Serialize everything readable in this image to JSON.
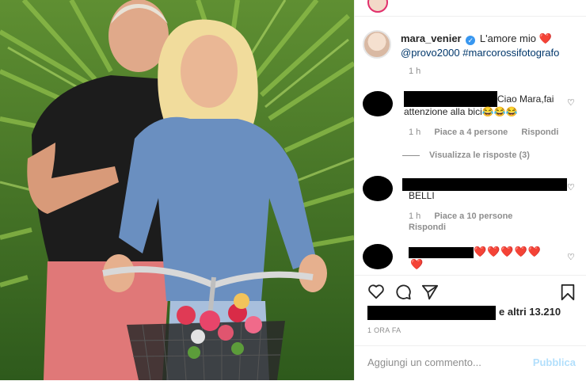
{
  "post": {
    "username": "mara_venier",
    "caption_text": "L'amore mio",
    "caption_emoji": "❤️",
    "mention": "@provo2000",
    "hashtag": "#marcorossifotografo",
    "time": "1 h",
    "verified_icon": "verified-badge-icon"
  },
  "comments": [
    {
      "text_line1": "Ciao Mara,fai",
      "text_line2": "attenzione alla bici😂😂😂",
      "time": "1 h",
      "likes": "Piace a 4 persone",
      "reply": "Rispondi",
      "view_replies": "Visualizza le risposte (3)"
    },
    {
      "text_line1": "BELLI",
      "time": "1 h",
      "likes": "Piace a 10 persone",
      "reply": "Rispondi"
    },
    {
      "hearts": "❤️❤️❤️❤️❤️",
      "hearts_line2": "❤️"
    }
  ],
  "likes": {
    "others": "e altri 13.210"
  },
  "timestamp": "1 ORA FA",
  "add_comment": {
    "placeholder": "Aggiungi un commento...",
    "publish_label": "Pubblica"
  },
  "colors": {
    "accent": "#3897f0",
    "link": "#00376b",
    "muted": "#8e8e8e",
    "publish_disabled": "#b2dffc",
    "heart": "#ed1c24"
  }
}
